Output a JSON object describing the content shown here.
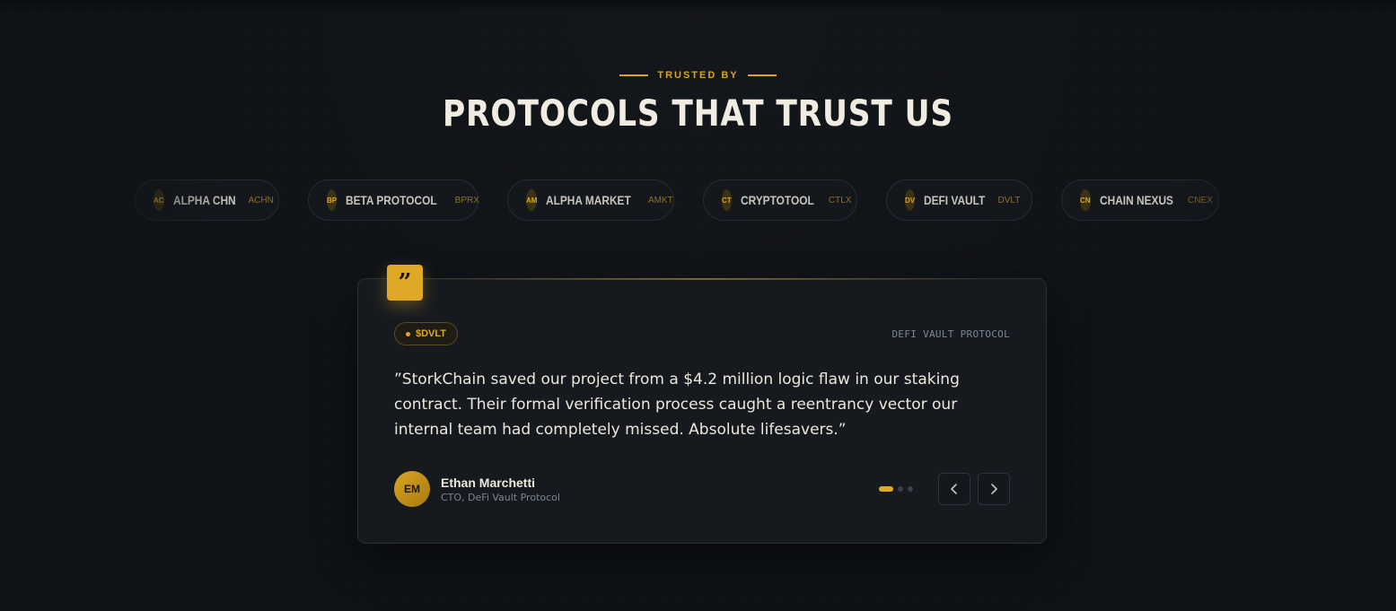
{
  "section": {
    "eyebrow": "TRUSTED BY",
    "title": "PROTOCOLS THAT TRUST US"
  },
  "protocols": [
    {
      "initials": "AC",
      "name": "ALPHA CHN",
      "ticker": "ACHN"
    },
    {
      "initials": "BP",
      "name": "BETA PROTOCOL",
      "ticker": "BPRX"
    },
    {
      "initials": "AM",
      "name": "ALPHA MARKET",
      "ticker": "AMKT"
    },
    {
      "initials": "CT",
      "name": "CRYPTOTOOL",
      "ticker": "CTLX"
    },
    {
      "initials": "DV",
      "name": "DEFI VAULT",
      "ticker": "DVLT"
    },
    {
      "initials": "CN",
      "name": "CHAIN NEXUS",
      "ticker": "CNEX"
    }
  ],
  "testimonial": {
    "quote_icon": "quote-icon",
    "ticker": "$DVLT",
    "protocol_label": "DEFI VAULT PROTOCOL",
    "quote": "”StorkChain saved our project from a $4.2 million logic flaw in our staking contract. Their formal verification process caught a reentrancy vector our internal team had completely missed. Absolute lifesavers.”",
    "author": {
      "initials": "EM",
      "name": "Ethan Marchetti",
      "role": "CTO, DeFi Vault Protocol"
    },
    "pagination": {
      "total": 3,
      "active": 1
    },
    "prev_icon": "chevron-left-icon",
    "next_icon": "chevron-right-icon"
  },
  "colors": {
    "accent": "#e0a925",
    "background": "#0f1216",
    "card": "#161a1f"
  }
}
